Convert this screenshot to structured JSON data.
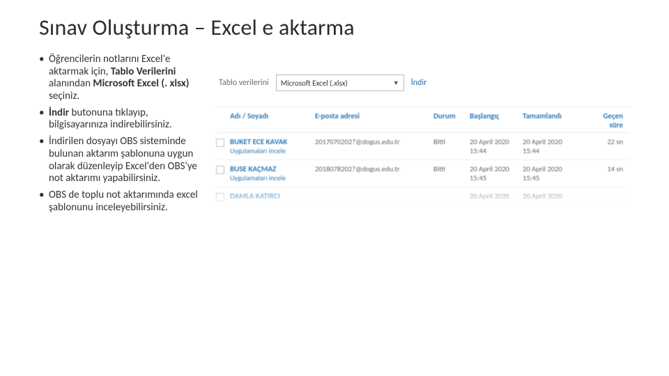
{
  "title": "Sınav Oluşturma – Excel e aktarma",
  "bullets": {
    "b1": {
      "p1": "Öğrencilerin notlarını Excel'e aktarmak için, ",
      "s1": "Tablo Verilerini",
      "p2": " alanından ",
      "s2": "Microsoft Excel (. xlsx)",
      "p3": " seçiniz."
    },
    "b2": {
      "s1": "İndir",
      "p1": " butonuna tıklayıp, bilgisayarınıza indirebilirsiniz."
    },
    "b3": "İndirilen dosyayı OBS sisteminde bulunan aktarım şablonuna uygun olarak düzenleyip Excel'den OBS'ye not aktarımı yapabilirsiniz.",
    "b4": "OBS de toplu not aktarımında excel şablonunu inceleyebilirsiniz."
  },
  "export": {
    "label": "Tablo verilerini",
    "value": "Microsoft Excel (.xlsx)",
    "download": "İndir"
  },
  "thead": {
    "name": "Adı / Soyadı",
    "email": "E-posta adresi",
    "status": "Durum",
    "start": "Başlangıç",
    "done": "Tamamlandı",
    "elapsed1": "Geçen",
    "elapsed2": "süre"
  },
  "rows": [
    {
      "name": "BUKET ECE KAVAK",
      "sub": "Uygulamaları incele",
      "email": "2017070202?@dogus.edu.tr",
      "status": "Bitti",
      "start1": "20 April 2020",
      "start2": "15:44",
      "done1": "20 April 2020",
      "done2": "15:44",
      "elapsed": "22 sn"
    },
    {
      "name": "BUSE KAÇMAZ",
      "sub": "Uygulamaları incele",
      "email": "2018078202?@dogus.edu.tr",
      "status": "Bitti",
      "start1": "20 April 2020",
      "start2": "15:45",
      "done1": "20 April 2020",
      "done2": "15:45",
      "elapsed": "14 sn"
    },
    {
      "name": "DAMLA KATIRCI",
      "sub": "",
      "email": "",
      "status": "",
      "start1": "20 April 2020",
      "start2": "",
      "done1": "20 April 2020",
      "done2": "",
      "elapsed": ""
    }
  ]
}
